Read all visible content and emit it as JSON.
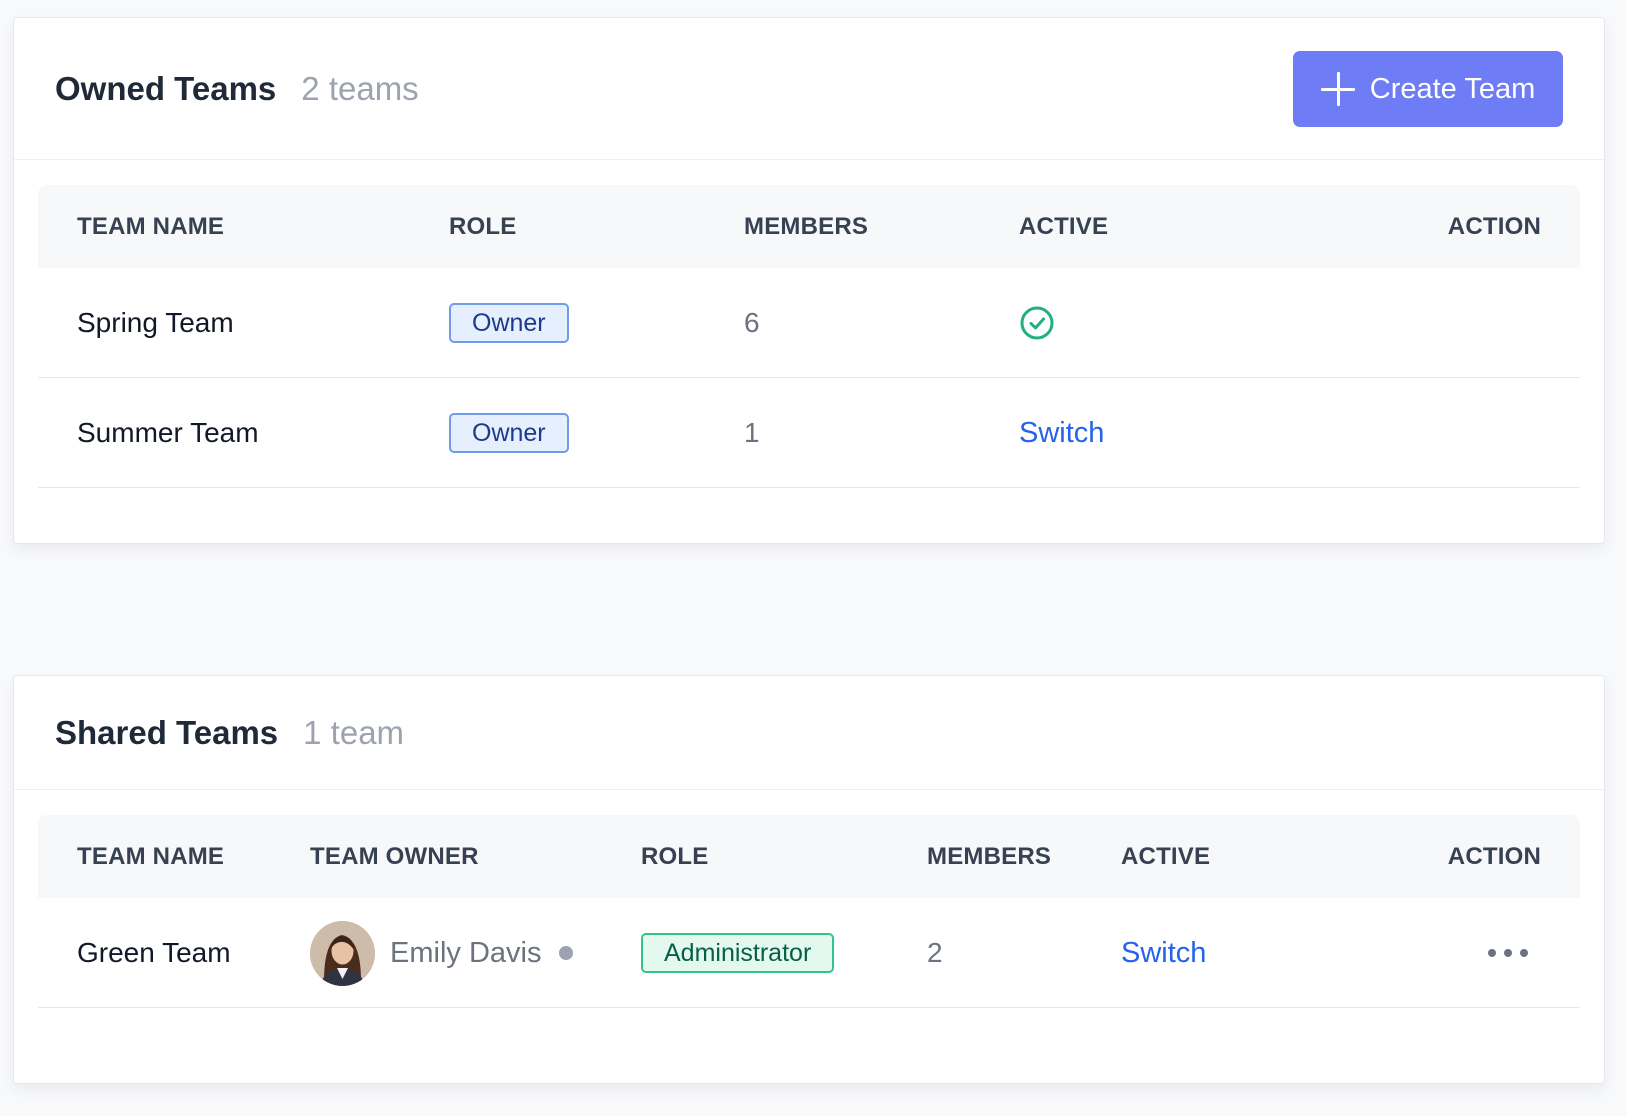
{
  "owned": {
    "title": "Owned Teams",
    "count": "2 teams",
    "create_label": "Create Team",
    "columns": [
      "TEAM NAME",
      "ROLE",
      "MEMBERS",
      "ACTIVE",
      "ACTION"
    ],
    "rows": [
      {
        "name": "Spring Team",
        "role": "Owner",
        "members": "6",
        "active": true,
        "active_label": ""
      },
      {
        "name": "Summer Team",
        "role": "Owner",
        "members": "1",
        "active": false,
        "active_label": "Switch"
      }
    ]
  },
  "shared": {
    "title": "Shared Teams",
    "count": "1 team",
    "columns": [
      "TEAM NAME",
      "TEAM OWNER",
      "ROLE",
      "MEMBERS",
      "ACTIVE",
      "ACTION"
    ],
    "rows": [
      {
        "name": "Green Team",
        "owner": "Emily Davis",
        "role": "Administrator",
        "members": "2",
        "active_label": "Switch"
      }
    ]
  },
  "colors": {
    "accent": "#6e7cf5",
    "link": "#2563eb",
    "success": "#22b07d",
    "badge_owner_bg": "#e6effd",
    "badge_admin_bg": "#e3f8ef"
  },
  "icons": {
    "create": "plus-icon",
    "active": "check-circle-icon",
    "status": "status-dot",
    "more": "more-horizontal-icon"
  }
}
